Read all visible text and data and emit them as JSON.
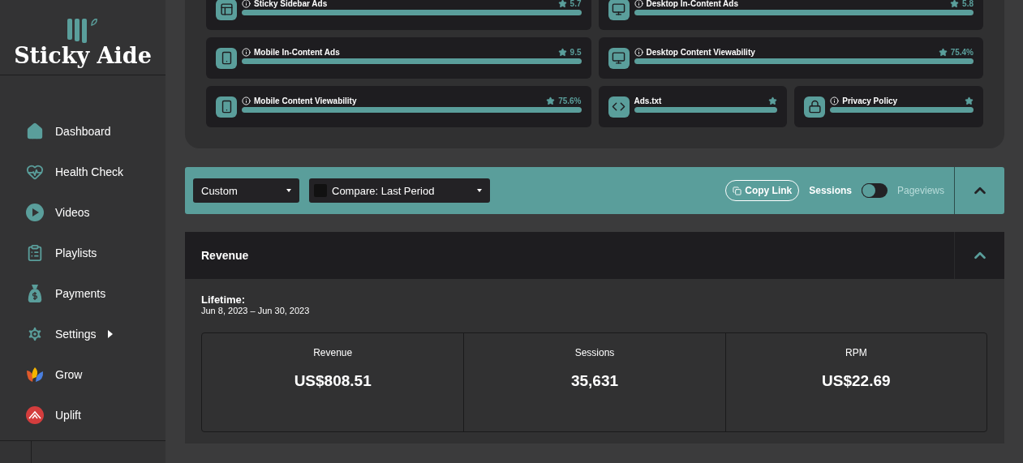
{
  "sidebar": {
    "brand": "Sticky Aide",
    "items": [
      {
        "label": "Dashboard",
        "submenu": false
      },
      {
        "label": "Health Check",
        "submenu": false
      },
      {
        "label": "Videos",
        "submenu": false
      },
      {
        "label": "Playlists",
        "submenu": false
      },
      {
        "label": "Payments",
        "submenu": false
      },
      {
        "label": "Settings",
        "submenu": true
      },
      {
        "label": "Grow",
        "submenu": false
      },
      {
        "label": "Uplift",
        "submenu": false
      }
    ]
  },
  "health_cards": [
    {
      "title": "Sticky Sidebar Ads",
      "score": "5.7",
      "info": true,
      "level": 1,
      "kind": "wide"
    },
    {
      "title": "Desktop In-Content Ads",
      "score": "5.8",
      "info": true,
      "level": 1,
      "kind": "wide"
    },
    {
      "title": "Mobile In-Content Ads",
      "score": "9.5",
      "info": true,
      "level": 1,
      "kind": "wide"
    },
    {
      "title": "Desktop Content Viewability",
      "score": "75.4%",
      "info": true,
      "level": 1,
      "kind": "wide"
    },
    {
      "title": "Mobile Content Viewability",
      "score": "75.6%",
      "info": true,
      "level": 1,
      "kind": "wide"
    },
    {
      "title": "Ads.txt",
      "info": false,
      "level": 1,
      "kind": "narrow"
    },
    {
      "title": "Privacy Policy",
      "info": true,
      "level": 1,
      "kind": "narrow"
    }
  ],
  "toolbar": {
    "range": "Custom",
    "compare": "Compare: Last Period",
    "copy_link": "Copy Link",
    "toggle_left": "Sessions",
    "toggle_right": "Pageviews",
    "on": false
  },
  "revenue": {
    "title": "Revenue",
    "period_label": "Lifetime:",
    "period": "Jun 8, 2023 – Jun 30, 2023",
    "metrics": [
      {
        "label": "Revenue",
        "value": "US$808.51"
      },
      {
        "label": "Sessions",
        "value": "35,631"
      },
      {
        "label": "RPM",
        "value": "US$22.69"
      }
    ]
  }
}
